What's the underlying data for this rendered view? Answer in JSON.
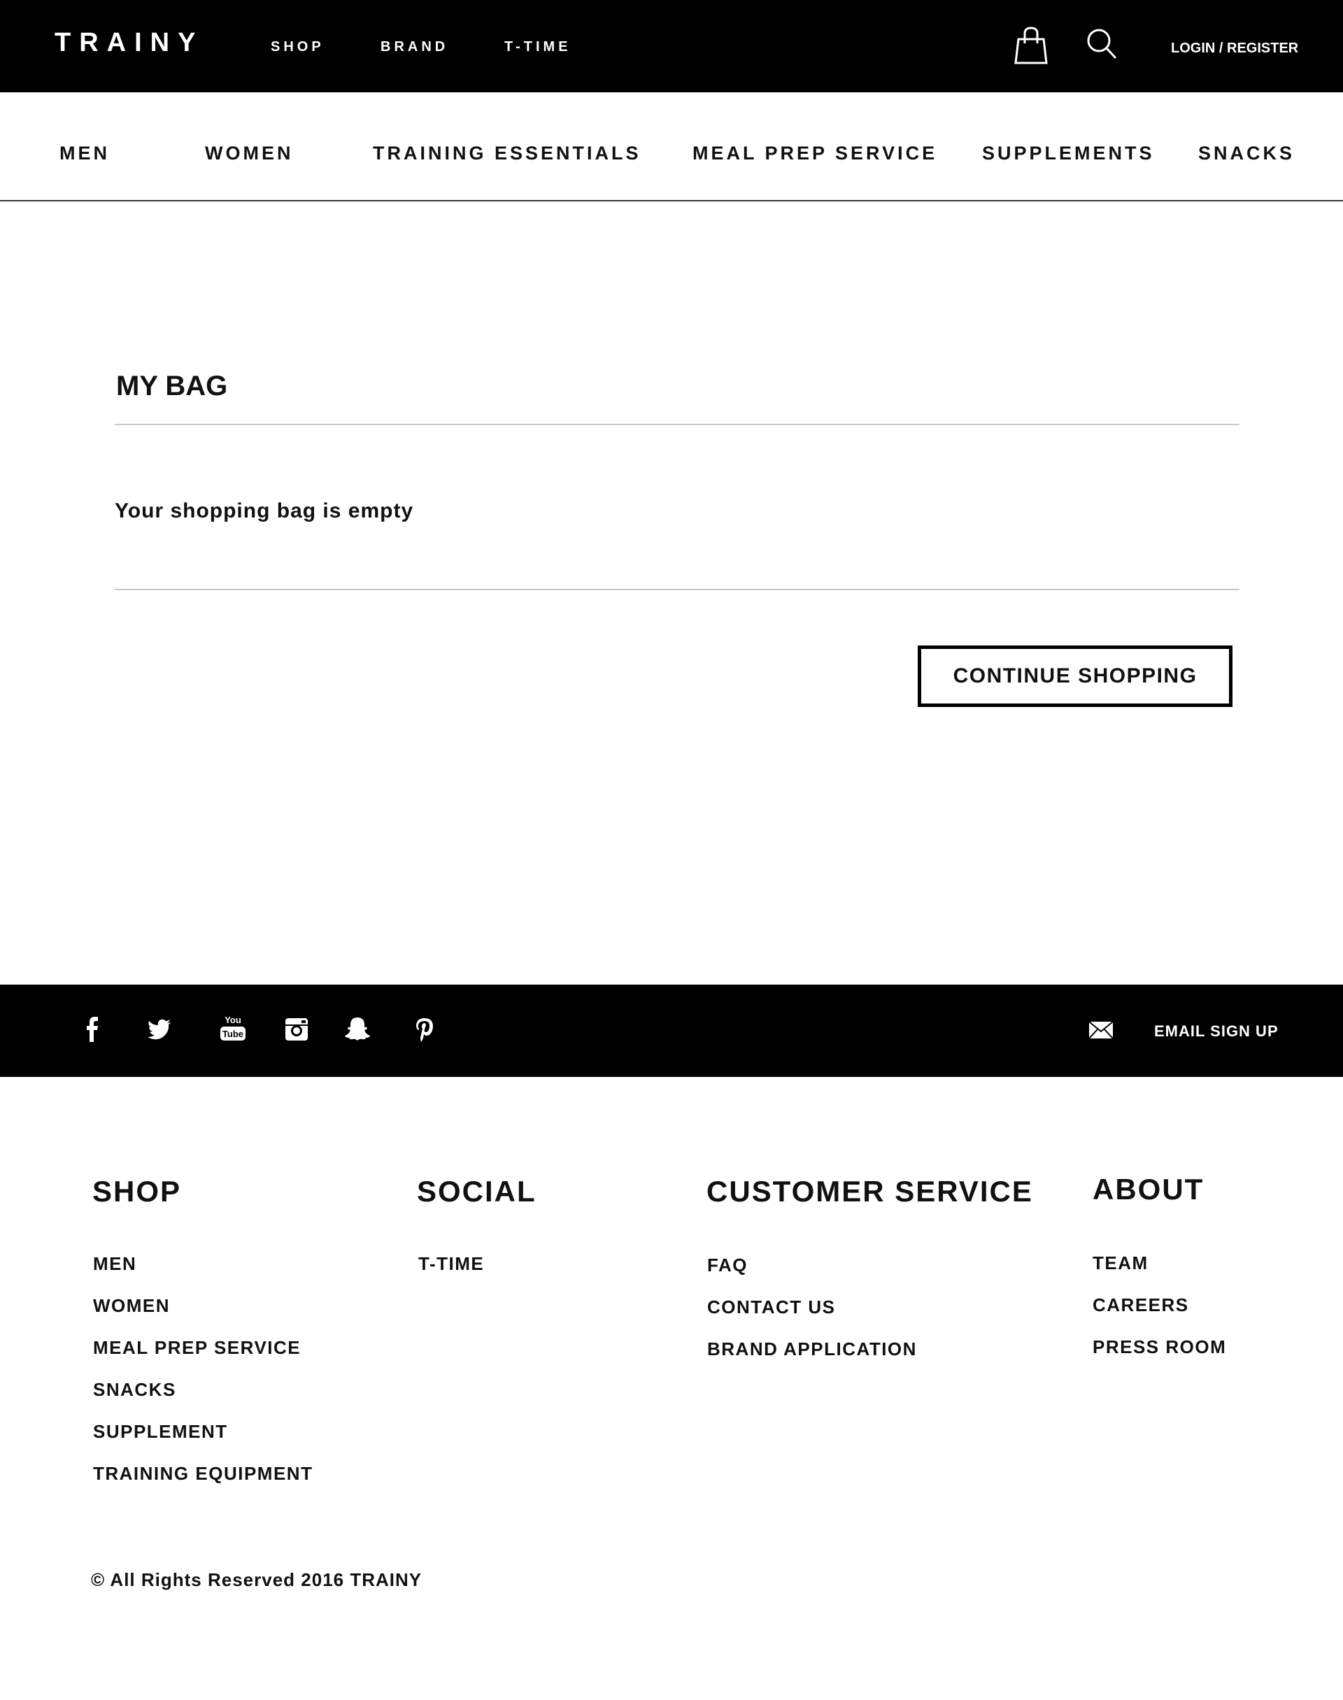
{
  "header": {
    "logo": "TRAINY",
    "nav": [
      "SHOP",
      "BRAND",
      "T-TIME"
    ],
    "login": "LOGIN / REGISTER"
  },
  "categories": [
    "MEN",
    "WOMEN",
    "TRAINING ESSENTIALS",
    "MEAL PREP SERVICE",
    "SUPPLEMENTS",
    "SNACKS"
  ],
  "bag": {
    "title": "MY BAG",
    "empty_message": "Your shopping bag is empty",
    "continue_label": "CONTINUE SHOPPING"
  },
  "social_bar": {
    "icons": [
      "facebook-icon",
      "twitter-icon",
      "youtube-icon",
      "instagram-icon",
      "snapchat-icon",
      "pinterest-icon"
    ],
    "email_signup": "EMAIL SIGN UP"
  },
  "footer": {
    "columns": [
      {
        "heading": "SHOP",
        "links": [
          "MEN",
          "WOMEN",
          "MEAL PREP SERVICE",
          "SNACKS",
          "SUPPLEMENT",
          "TRAINING EQUIPMENT"
        ]
      },
      {
        "heading": "SOCIAL",
        "links": [
          "T-TIME"
        ]
      },
      {
        "heading": "CUSTOMER SERVICE",
        "links": [
          "FAQ",
          "CONTACT US",
          "BRAND APPLICATION"
        ]
      },
      {
        "heading": "ABOUT",
        "links": [
          "TEAM",
          "CAREERS",
          "PRESS ROOM"
        ]
      }
    ],
    "copyright": "© All Rights Reserved 2016 TRAINY"
  },
  "colors": {
    "bar_background": "#000000",
    "page_background": "#ffffff",
    "text": "#111111",
    "divider": "#c8c8c8"
  }
}
